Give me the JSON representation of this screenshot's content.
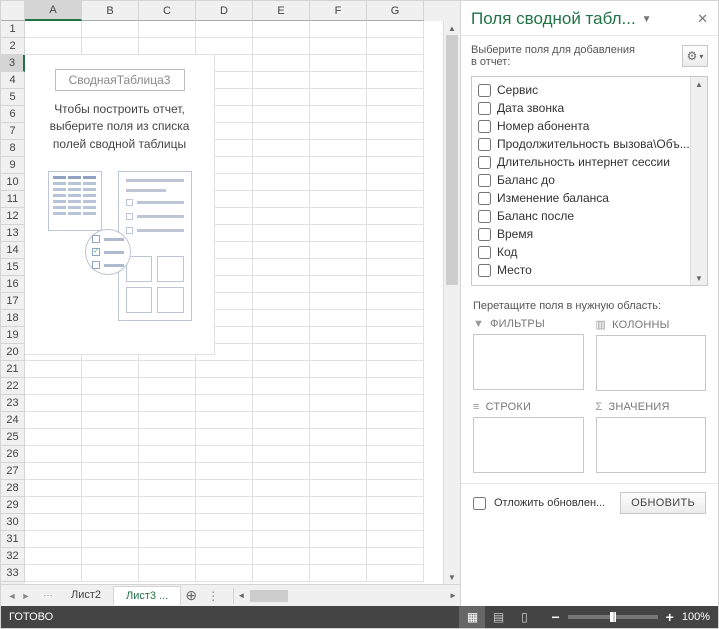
{
  "sheet": {
    "columns": [
      "A",
      "B",
      "C",
      "D",
      "E",
      "F",
      "G"
    ],
    "rows": [
      "1",
      "2",
      "3",
      "4",
      "5",
      "6",
      "7",
      "8",
      "9",
      "10",
      "11",
      "12",
      "13",
      "14",
      "15",
      "16",
      "17",
      "18",
      "19",
      "20",
      "21",
      "22",
      "23",
      "24",
      "25",
      "26",
      "27",
      "28",
      "29",
      "30",
      "31",
      "32",
      "33"
    ],
    "active_col_index": 0,
    "active_row_index": 2,
    "pivot_placeholder": {
      "name": "СводнаяТаблица3",
      "message_l1": "Чтобы построить отчет,",
      "message_l2": "выберите поля из списка",
      "message_l3": "полей сводной таблицы"
    },
    "tabs": [
      "Лист2",
      "Лист3"
    ],
    "active_tab_index": 1
  },
  "panel": {
    "title": "Поля сводной табл...",
    "subtitle_l1": "Выберите поля для добавления",
    "subtitle_l2": "в отчет:",
    "fields": [
      {
        "label": "Сервис",
        "checked": false
      },
      {
        "label": "Дата звонка",
        "checked": false
      },
      {
        "label": "Номер абонента",
        "checked": false
      },
      {
        "label": "Продолжительность вызова\\Объ...",
        "checked": false
      },
      {
        "label": "Длительность интернет сессии",
        "checked": false
      },
      {
        "label": "Баланс до",
        "checked": false
      },
      {
        "label": "Изменение баланса",
        "checked": false
      },
      {
        "label": "Баланс после",
        "checked": false
      },
      {
        "label": "Время",
        "checked": false
      },
      {
        "label": "Код",
        "checked": false
      },
      {
        "label": "Место",
        "checked": false
      }
    ],
    "drag_hint": "Перетащите поля в нужную область:",
    "zones": {
      "filters": "ФИЛЬТРЫ",
      "columns": "КОЛОННЫ",
      "rows": "СТРОКИ",
      "values": "ЗНАЧЕНИЯ"
    },
    "defer_label": "Отложить обновлен...",
    "defer_checked": false,
    "update_label": "ОБНОВИТЬ"
  },
  "status": {
    "ready": "ГОТОВО",
    "zoom": "100%"
  }
}
